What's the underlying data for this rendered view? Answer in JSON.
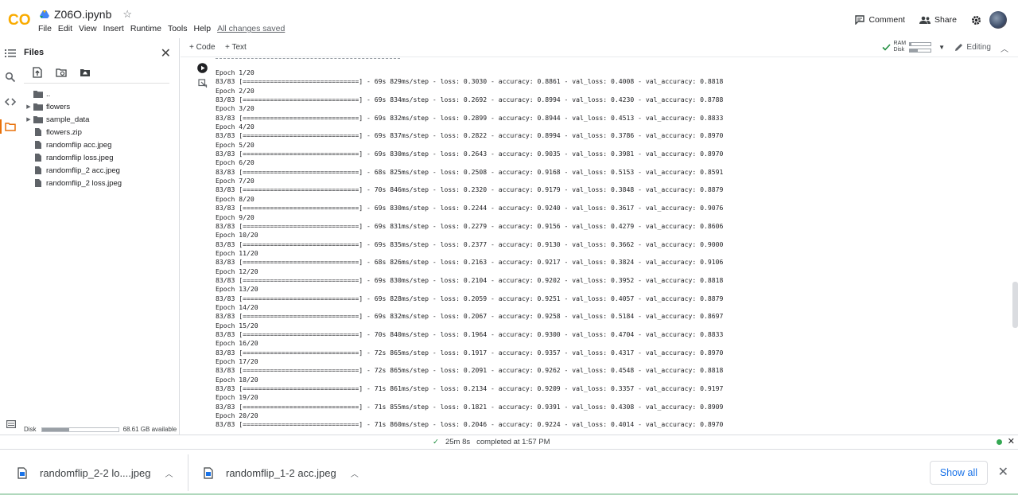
{
  "header": {
    "logo_text": "CO",
    "notebook_title": "Z06O.ipynb",
    "menu": [
      "File",
      "Edit",
      "View",
      "Insert",
      "Runtime",
      "Tools",
      "Help"
    ],
    "save_status": "All changes saved",
    "comment_label": "Comment",
    "share_label": "Share"
  },
  "sidebar": {
    "title": "Files",
    "items": [
      {
        "label": "..",
        "type": "folder",
        "expandable": false
      },
      {
        "label": "flowers",
        "type": "folder",
        "expandable": true
      },
      {
        "label": "sample_data",
        "type": "folder",
        "expandable": true
      },
      {
        "label": "flowers.zip",
        "type": "file",
        "expandable": false
      },
      {
        "label": "randomflip acc.jpeg",
        "type": "file",
        "expandable": false
      },
      {
        "label": "randomflip loss.jpeg",
        "type": "file",
        "expandable": false
      },
      {
        "label": "randomflip_2 acc.jpeg",
        "type": "file",
        "expandable": false
      },
      {
        "label": "randomflip_2 loss.jpeg",
        "type": "file",
        "expandable": false
      }
    ],
    "disk_label": "Disk",
    "disk_available": "68.61 GB available",
    "disk_used_fraction": 0.36
  },
  "toolbar": {
    "add_code": "+ Code",
    "add_text": "+ Text",
    "ram_label": "RAM",
    "disk_label": "Disk",
    "ram_used_fraction": 0.08,
    "disk_used_fraction": 0.4,
    "editing_label": "Editing"
  },
  "output": {
    "bar": "[==============================]",
    "epochs": [
      {
        "epoch": "Epoch 1/20",
        "time": "69s 829ms/step",
        "loss": "0.3030",
        "accuracy": "0.8861",
        "val_loss": "0.4008",
        "val_accuracy": "0.8818"
      },
      {
        "epoch": "Epoch 2/20",
        "time": "69s 834ms/step",
        "loss": "0.2692",
        "accuracy": "0.8994",
        "val_loss": "0.4230",
        "val_accuracy": "0.8788"
      },
      {
        "epoch": "Epoch 3/20",
        "time": "69s 832ms/step",
        "loss": "0.2899",
        "accuracy": "0.8944",
        "val_loss": "0.4513",
        "val_accuracy": "0.8833"
      },
      {
        "epoch": "Epoch 4/20",
        "time": "69s 837ms/step",
        "loss": "0.2822",
        "accuracy": "0.8994",
        "val_loss": "0.3786",
        "val_accuracy": "0.8970"
      },
      {
        "epoch": "Epoch 5/20",
        "time": "69s 830ms/step",
        "loss": "0.2643",
        "accuracy": "0.9035",
        "val_loss": "0.3981",
        "val_accuracy": "0.8970"
      },
      {
        "epoch": "Epoch 6/20",
        "time": "68s 825ms/step",
        "loss": "0.2508",
        "accuracy": "0.9168",
        "val_loss": "0.5153",
        "val_accuracy": "0.8591"
      },
      {
        "epoch": "Epoch 7/20",
        "time": "70s 846ms/step",
        "loss": "0.2320",
        "accuracy": "0.9179",
        "val_loss": "0.3848",
        "val_accuracy": "0.8879"
      },
      {
        "epoch": "Epoch 8/20",
        "time": "69s 830ms/step",
        "loss": "0.2244",
        "accuracy": "0.9240",
        "val_loss": "0.3617",
        "val_accuracy": "0.9076"
      },
      {
        "epoch": "Epoch 9/20",
        "time": "69s 831ms/step",
        "loss": "0.2279",
        "accuracy": "0.9156",
        "val_loss": "0.4279",
        "val_accuracy": "0.8606"
      },
      {
        "epoch": "Epoch 10/20",
        "time": "69s 835ms/step",
        "loss": "0.2377",
        "accuracy": "0.9130",
        "val_loss": "0.3662",
        "val_accuracy": "0.9000"
      },
      {
        "epoch": "Epoch 11/20",
        "time": "68s 826ms/step",
        "loss": "0.2163",
        "accuracy": "0.9217",
        "val_loss": "0.3824",
        "val_accuracy": "0.9106"
      },
      {
        "epoch": "Epoch 12/20",
        "time": "69s 830ms/step",
        "loss": "0.2104",
        "accuracy": "0.9202",
        "val_loss": "0.3952",
        "val_accuracy": "0.8818"
      },
      {
        "epoch": "Epoch 13/20",
        "time": "69s 828ms/step",
        "loss": "0.2059",
        "accuracy": "0.9251",
        "val_loss": "0.4057",
        "val_accuracy": "0.8879"
      },
      {
        "epoch": "Epoch 14/20",
        "time": "69s 832ms/step",
        "loss": "0.2067",
        "accuracy": "0.9258",
        "val_loss": "0.5184",
        "val_accuracy": "0.8697"
      },
      {
        "epoch": "Epoch 15/20",
        "time": "70s 840ms/step",
        "loss": "0.1964",
        "accuracy": "0.9300",
        "val_loss": "0.4704",
        "val_accuracy": "0.8833"
      },
      {
        "epoch": "Epoch 16/20",
        "time": "72s 865ms/step",
        "loss": "0.1917",
        "accuracy": "0.9357",
        "val_loss": "0.4317",
        "val_accuracy": "0.8970"
      },
      {
        "epoch": "Epoch 17/20",
        "time": "72s 865ms/step",
        "loss": "0.2091",
        "accuracy": "0.9262",
        "val_loss": "0.4548",
        "val_accuracy": "0.8818"
      },
      {
        "epoch": "Epoch 18/20",
        "time": "71s 861ms/step",
        "loss": "0.2134",
        "accuracy": "0.9209",
        "val_loss": "0.3357",
        "val_accuracy": "0.9197"
      },
      {
        "epoch": "Epoch 19/20",
        "time": "71s 855ms/step",
        "loss": "0.1821",
        "accuracy": "0.9391",
        "val_loss": "0.4308",
        "val_accuracy": "0.8909"
      },
      {
        "epoch": "Epoch 20/20",
        "time": "71s 860ms/step",
        "loss": "0.2046",
        "accuracy": "0.9224",
        "val_loss": "0.4014",
        "val_accuracy": "0.8970"
      }
    ],
    "steps": "83/83"
  },
  "status": {
    "elapsed": "25m 8s",
    "completed": "completed at 1:57 PM"
  },
  "downloads": {
    "items": [
      "randomflip_2-2 lo....jpeg",
      "randomflip_1-2 acc.jpeg"
    ],
    "show_all": "Show all"
  },
  "colors": {
    "logo_orange": "#f9ab00",
    "logo_dark_orange": "#e8710a",
    "accent_blue": "#1a73e8",
    "status_green": "#34a853"
  }
}
